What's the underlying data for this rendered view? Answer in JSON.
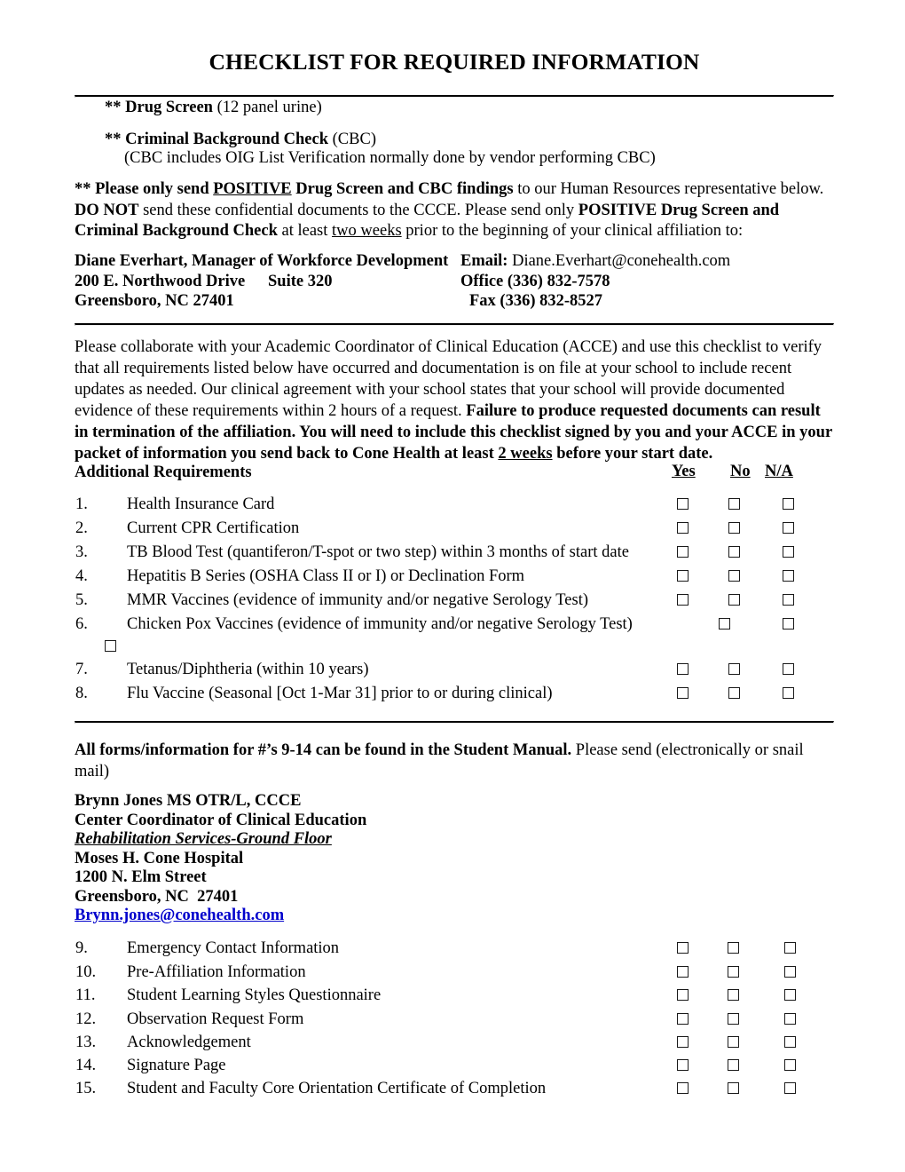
{
  "document": {
    "title": "CHECKLIST FOR REQUIRED INFORMATION"
  },
  "top_requirements": {
    "drug_screen": {
      "marker": "** ",
      "bold": "Drug Screen",
      "rest": " (12 panel urine)"
    },
    "cbc": {
      "marker": "** ",
      "bold": "Criminal Background Check",
      "rest": " (CBC)",
      "sub": "(CBC includes OIG List Verification normally done by vendor performing CBC)"
    }
  },
  "positive_notice": {
    "p1_b1": "** Please only send ",
    "p1_u": "POSITIVE",
    "p1_b2": " Drug Screen and CBC findings",
    "p1_n": " to our Human Resources representative below. ",
    "p2_b": "DO NOT",
    "p2_n": " send these confidential documents to the CCCE.  Please send only ",
    "p2_b2": "POSITIVE Drug Screen and Criminal Background Check",
    "p3_n": " at least ",
    "p3_u": "two weeks",
    "p3_n2": " prior to the beginning of your clinical affiliation to:"
  },
  "hr_contact": {
    "name_title": "Diane Everhart, Manager of Workforce Development",
    "email_label": "Email: ",
    "email_value": "Diane.Everhart@conehealth.com",
    "street": "200 E. Northwood Drive",
    "suite": "Suite 320",
    "office": "Office (336) 832-7578",
    "city_state_zip": "Greensboro, NC 27401",
    "fax": "Fax (336) 832-8527"
  },
  "collaborate": {
    "normal_1": "Please collaborate with your Academic Coordinator of Clinical Education (ACCE) and use this checklist to verify that all requirements listed below have occurred and documentation is on file at your school to include recent updates as needed.   Our clinical agreement with your school states that your school will provide documented evidence of these requirements within 2 hours of a request. ",
    "bold_1": "Failure to produce requested documents can result in termination of the affiliation.  You will need to include this checklist signed by you and your ACCE in your packet of information you send back to Cone Health at least ",
    "bold_u": "2 weeks",
    "bold_2": " before your start date."
  },
  "checklist": {
    "section_label": "Additional Requirements",
    "columns": {
      "yes": "Yes",
      "no": "No",
      "na": "N/A"
    },
    "items_part1": [
      {
        "num": "1.",
        "label": "Health Insurance Card"
      },
      {
        "num": "2.",
        "label": "Current CPR Certification"
      },
      {
        "num": "3.",
        "label": "TB Blood Test (quantiferon/T-spot or two step) within 3 months of start date"
      },
      {
        "num": "4.",
        "label": "Hepatitis B Series (OSHA Class II or I) or Declination Form"
      },
      {
        "num": "5.",
        "label": "MMR Vaccines (evidence of immunity and/or negative Serology Test)"
      },
      {
        "num": "6.",
        "label": "Chicken Pox Vaccines (evidence of immunity and/or negative Serology Test)"
      },
      {
        "num": "7.",
        "label": "Tetanus/Diphtheria (within 10 years)"
      },
      {
        "num": "8.",
        "label": "Flu Vaccine (Seasonal [Oct 1-Mar 31] prior to or during clinical)"
      }
    ],
    "items_part2": [
      {
        "num": "9.",
        "label": "Emergency Contact Information"
      },
      {
        "num": "10.",
        "label": "Pre-Affiliation Information"
      },
      {
        "num": "11.",
        "label": "Student Learning Styles Questionnaire"
      },
      {
        "num": "12.",
        "label": "Observation Request Form"
      },
      {
        "num": "13.",
        "label": "Acknowledgement"
      },
      {
        "num": "14.",
        "label": "Signature Page"
      },
      {
        "num": "15.",
        "label": "Student and Faculty Core Orientation Certificate of Completion"
      }
    ]
  },
  "student_manual": {
    "bold": "All forms/information for #’s 9-14 can be found in the Student Manual.",
    "normal": "  Please send (electronically or snail mail)"
  },
  "ccce_contact": {
    "name": "Brynn Jones MS OTR/L, CCCE",
    "role": "Center Coordinator of Clinical Education",
    "department": "Rehabilitation Services-Ground Floor",
    "hospital": "Moses H. Cone Hospital",
    "street": "1200 N. Elm Street",
    "city_state_zip": "Greensboro, NC  27401",
    "email": "Brynn.jones@conehealth.com"
  },
  "colors": {
    "link": "#0000cc",
    "text": "#000000",
    "rule": "#000000"
  }
}
